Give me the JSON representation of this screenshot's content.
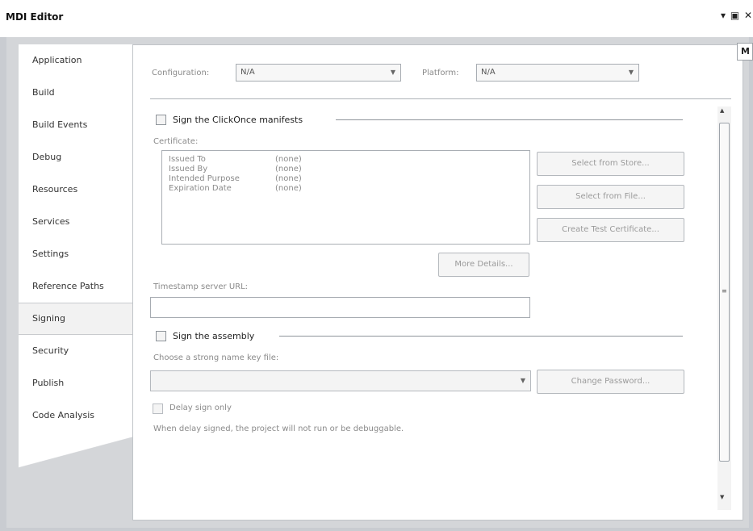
{
  "window": {
    "title": "MDI Editor",
    "controls": "▾ ▣ ✕",
    "side_tab": "M"
  },
  "sidebar": {
    "items": [
      {
        "label": "Application"
      },
      {
        "label": "Build"
      },
      {
        "label": "Build Events"
      },
      {
        "label": "Debug"
      },
      {
        "label": "Resources"
      },
      {
        "label": "Services"
      },
      {
        "label": "Settings"
      },
      {
        "label": "Reference Paths"
      },
      {
        "label": "Signing"
      },
      {
        "label": "Security"
      },
      {
        "label": "Publish"
      },
      {
        "label": "Code Analysis"
      }
    ],
    "active": "Signing"
  },
  "config": {
    "configuration_label": "Configuration:",
    "configuration_value": "N/A",
    "platform_label": "Platform:",
    "platform_value": "N/A"
  },
  "clickonce": {
    "checkbox_label": "Sign the ClickOnce manifests",
    "checked": false,
    "certificate_label": "Certificate:",
    "fields": [
      {
        "name": "Issued To",
        "value": "(none)"
      },
      {
        "name": "Issued By",
        "value": "(none)"
      },
      {
        "name": "Intended Purpose",
        "value": "(none)"
      },
      {
        "name": "Expiration Date",
        "value": "(none)"
      }
    ],
    "select_from_store": "Select from Store...",
    "select_from_file": "Select from File...",
    "create_test_certificate": "Create Test Certificate...",
    "more_details": "More Details...",
    "timestamp_label": "Timestamp server URL:",
    "timestamp_value": ""
  },
  "assembly": {
    "checkbox_label": "Sign the assembly",
    "checked": false,
    "key_file_label": "Choose a strong name key file:",
    "key_file_value": "",
    "change_password": "Change Password...",
    "delay_sign_label": "Delay sign only",
    "delay_sign_checked": false,
    "delay_note": "When delay signed, the project will not run or be debuggable."
  },
  "colors": {
    "chrome": "#c9ccd1",
    "panel": "#ffffff",
    "disabled_text": "#8a8a8a"
  }
}
